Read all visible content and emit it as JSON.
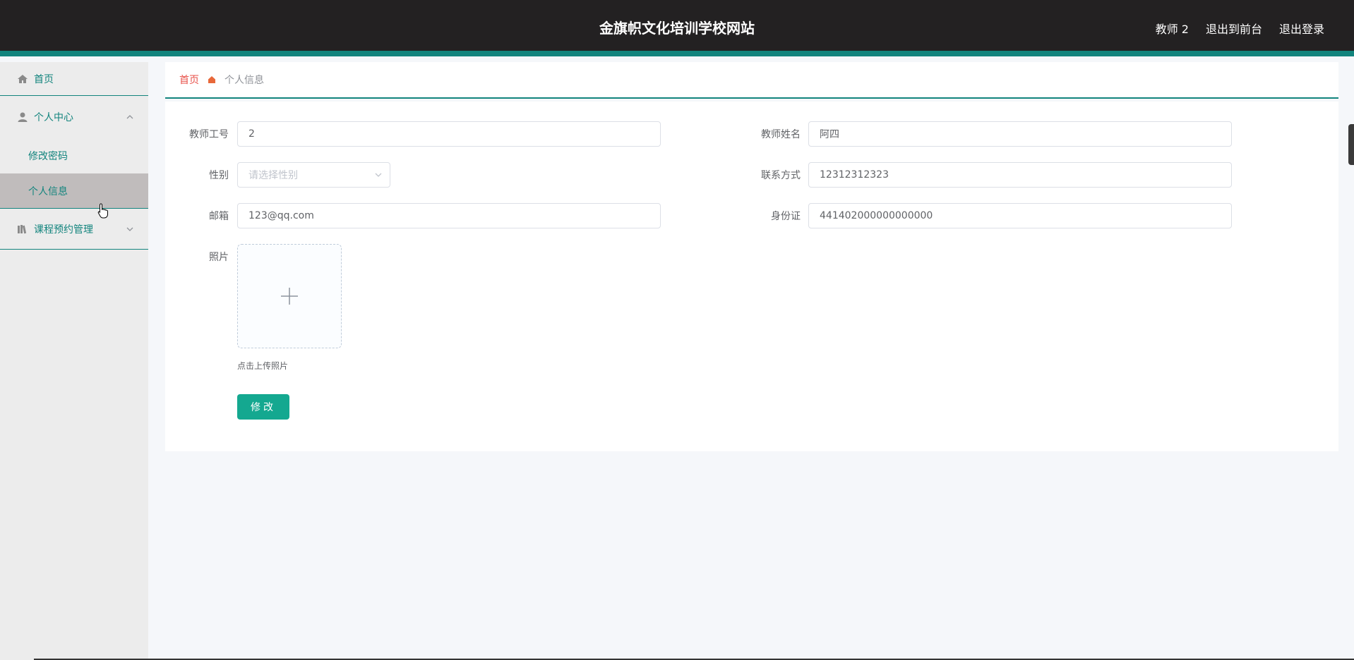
{
  "header": {
    "title": "金旗帜文化培训学校网站",
    "nav": [
      "教师 2",
      "退出到前台",
      "退出登录"
    ]
  },
  "sidebar": {
    "home": "首页",
    "center": "个人中心",
    "center_items": [
      "修改密码",
      "个人信息"
    ],
    "course": "课程预约管理"
  },
  "breadcrumb": {
    "home": "首页",
    "current": "个人信息"
  },
  "form": {
    "teacher_id_label": "教师工号",
    "teacher_id_value": "2",
    "teacher_name_label": "教师姓名",
    "teacher_name_value": "阿四",
    "gender_label": "性别",
    "gender_placeholder": "请选择性别",
    "phone_label": "联系方式",
    "phone_value": "12312312323",
    "email_label": "邮箱",
    "email_value": "123@qq.com",
    "id_card_label": "身份证",
    "id_card_value": "441402000000000000",
    "photo_label": "照片",
    "photo_hint": "点击上传照片",
    "submit_label": "修改"
  },
  "colors": {
    "accent": "#12847d",
    "button": "#14a890",
    "header_bg": "#232122",
    "breadcrumb_home": "#e8514a"
  }
}
